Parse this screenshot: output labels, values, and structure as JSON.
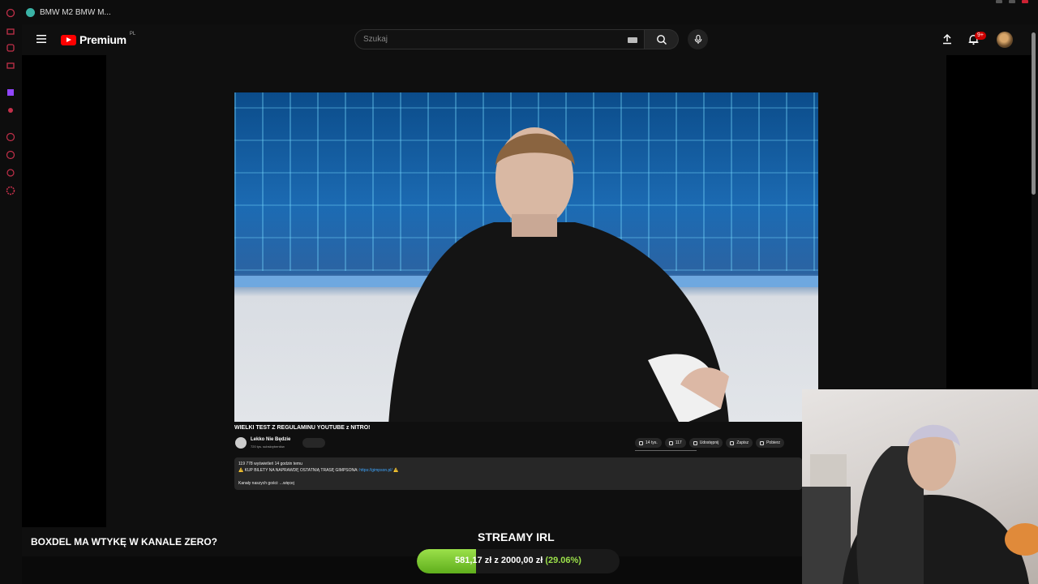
{
  "tab": {
    "title": "BMW M2 BMW M..."
  },
  "header": {
    "logo_text": "Premium",
    "logo_country": "PL",
    "search_placeholder": "Szukaj",
    "notification_badge": "9+"
  },
  "video": {
    "title": "WIELKI TEST Z REGULAMINU YOUTUBE z NITRO!",
    "channel_name": "Lekko Nie Będzie",
    "channel_subs": "720 tys. subskrybentów",
    "actions": {
      "like_count": "14 tys.",
      "dislike_count": "117",
      "share": "Udostępnij",
      "save": "Zapisz",
      "download": "Pobierz"
    },
    "description": {
      "line1": "119 778 wyświetleń  14 godzin temu",
      "line2": "⚠️ KUP BILETY NA NAPRAWDĘ OSTATNIĄ TRASĘ GIMPSONA: ",
      "link": "https://gimpson.pl/",
      "line2_end": " ⚠️",
      "line3": "Kanały naszych gości: ...więcej"
    }
  },
  "stream_overlay": {
    "headline": "BOXDEL MA WTYKĘ W KANALE ZERO?",
    "streamy_label": "STREAMY IRL",
    "donation_text": "581,17 zł z 2000,00 zł",
    "donation_percent": "(29.06%)",
    "donation_progress": 0.2906
  },
  "colors": {
    "brand_red": "#ff0000",
    "progress_green": "#9be04a",
    "link_blue": "#3ea6ff"
  }
}
